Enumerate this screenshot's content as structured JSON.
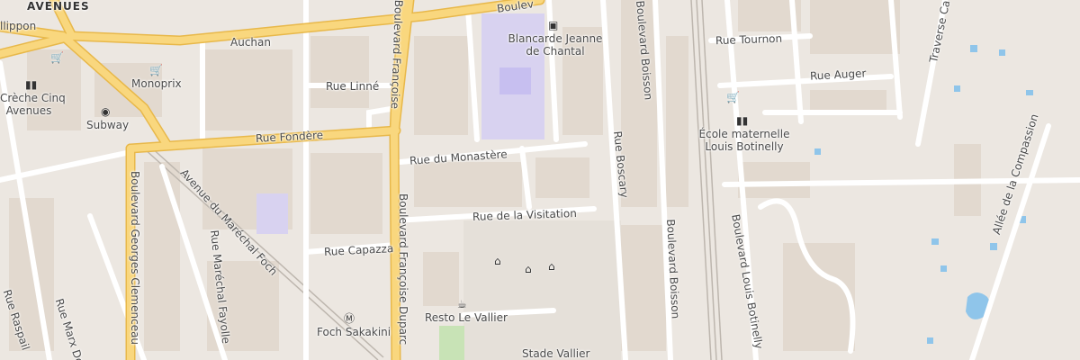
{
  "map": {
    "district_label": "AVENUES",
    "partial_street": "llippon",
    "colors": {
      "background": "#ece7e1",
      "block": "#e2d9cf",
      "road_minor": "#ffffff",
      "road_major": "#f9d77e",
      "road_major_casing": "#e8b84a",
      "school": "#d8d2f0",
      "water": "#8fc5ea",
      "sport": "#c8e3b6",
      "railway": "#bdb6ae"
    },
    "streets": {
      "boulevard_top": "Boulev",
      "auchan": "Auchan",
      "rue_linne": "Rue Linné",
      "rue_fondere": "Rue Fondère",
      "rue_monastere": "Rue du Monastère",
      "rue_visitation": "Rue de la Visitation",
      "rue_capazza": "Rue Capazza",
      "bd_francoise_duparc_top": "Boulevard Françoise",
      "bd_francoise_duparc_bottom": "Boulevard Françoise Duparc",
      "av_marechal_foch": "Avenue du Maréchal Foch",
      "bd_georges_clemenceau": "Boulevard Georges Clemenceau",
      "rue_marechal_fayolle": "Rue Maréchal Fayolle",
      "rue_raspail": "Rue Raspail",
      "rue_marx_dormoy": "Rue Marx Do",
      "rue_boscary": "Rue Boscary",
      "bd_boisson_top": "Boulevard Boisson",
      "bd_boisson_bottom": "Boulevard Boisson",
      "bd_louis_botinelly": "Boulevard Louis Botinelly",
      "rue_tournon": "Rue Tournon",
      "rue_auger": "Rue Auger",
      "traverse_ca": "Traverse Ca",
      "allee_compassion": "Allée de la Compassion"
    },
    "pois": {
      "monoprix": "Monoprix",
      "creche": "Crèche Cinq Avenues",
      "creche_line1": "Crèche Cinq",
      "creche_line2": "Avenues",
      "subway": "Subway",
      "blancarde": "Blancarde Jeanne de Chantal",
      "blancarde_line1": "Blancarde Jeanne",
      "blancarde_line2": "de Chantal",
      "ecole": "École maternelle Louis Botinelly",
      "ecole_line1": "École maternelle",
      "ecole_line2": "Louis Botinelly",
      "resto": "Resto Le Vallier",
      "foch": "Foch Sakakini",
      "stade": "Stade Vallier"
    },
    "icons": {
      "shop": "shop-icon",
      "school": "school-icon",
      "fastfood": "fastfood-icon",
      "bus": "bus-icon",
      "metro": "metro-icon",
      "restaurant": "restaurant-icon",
      "sport": "sport-icon"
    }
  }
}
